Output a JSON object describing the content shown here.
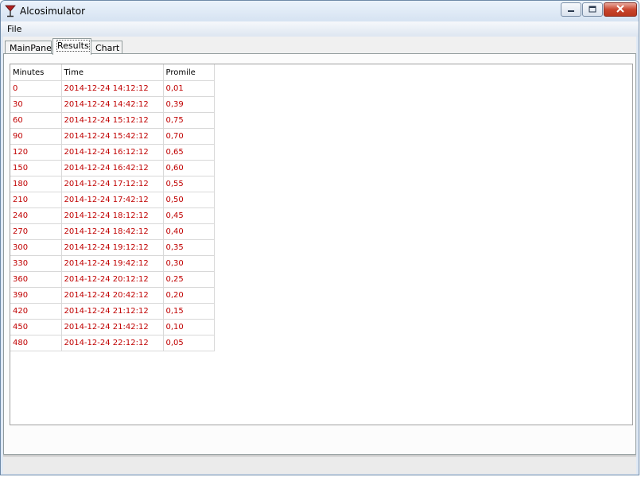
{
  "window": {
    "title": "Alcosimulator"
  },
  "menu": {
    "file": "File"
  },
  "tabs": [
    {
      "label": "MainPanel"
    },
    {
      "label": "Results"
    },
    {
      "label": "Chart"
    }
  ],
  "table": {
    "headers": [
      "Minutes",
      "Time",
      "Promile"
    ],
    "rows": [
      [
        "0",
        "2014-12-24 14:12:12",
        "0,01"
      ],
      [
        "30",
        "2014-12-24 14:42:12",
        "0,39"
      ],
      [
        "60",
        "2014-12-24 15:12:12",
        "0,75"
      ],
      [
        "90",
        "2014-12-24 15:42:12",
        "0,70"
      ],
      [
        "120",
        "2014-12-24 16:12:12",
        "0,65"
      ],
      [
        "150",
        "2014-12-24 16:42:12",
        "0,60"
      ],
      [
        "180",
        "2014-12-24 17:12:12",
        "0,55"
      ],
      [
        "210",
        "2014-12-24 17:42:12",
        "0,50"
      ],
      [
        "240",
        "2014-12-24 18:12:12",
        "0,45"
      ],
      [
        "270",
        "2014-12-24 18:42:12",
        "0,40"
      ],
      [
        "300",
        "2014-12-24 19:12:12",
        "0,35"
      ],
      [
        "330",
        "2014-12-24 19:42:12",
        "0,30"
      ],
      [
        "360",
        "2014-12-24 20:12:12",
        "0,25"
      ],
      [
        "390",
        "2014-12-24 20:42:12",
        "0,20"
      ],
      [
        "420",
        "2014-12-24 21:12:12",
        "0,15"
      ],
      [
        "450",
        "2014-12-24 21:42:12",
        "0,10"
      ],
      [
        "480",
        "2014-12-24 22:12:12",
        "0,05"
      ]
    ]
  },
  "colors": {
    "cell_text": "#c00000",
    "window_frame": "#6f8aa8",
    "close_button": "#c9462e"
  },
  "icons": {
    "app": "martini-glass-icon",
    "minimize": "minimize-icon",
    "maximize": "maximize-icon",
    "close": "close-icon"
  }
}
